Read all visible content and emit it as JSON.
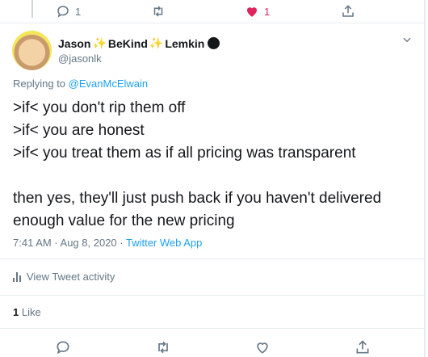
{
  "previous_tweet": {
    "reply_count": "1",
    "like_count": "1"
  },
  "tweet": {
    "author_name_first": "Jason",
    "author_name_middle": "BeKind",
    "author_name_last": "Lemkin",
    "sparkle_glyph": "✨",
    "handle": "@jasonlk",
    "replying_to_prefix": "Replying to",
    "replying_to_handle": "@EvanMcElwain",
    "lines": [
      ">if< you don't rip them off",
      ">if< you are honest",
      ">if< you treat them as if all pricing was transparent",
      "",
      "then yes, they'll just push back if you haven't delivered",
      "enough value for the new pricing"
    ],
    "timestamp": "7:41 AM · Aug 8, 2020 · ",
    "source": "Twitter Web App",
    "activity_label": "View Tweet activity",
    "likes_count": "1",
    "likes_label": "Like"
  },
  "colors": {
    "accent": "#1da1f2",
    "heart": "#e0245e",
    "secondary_text": "#657786"
  }
}
